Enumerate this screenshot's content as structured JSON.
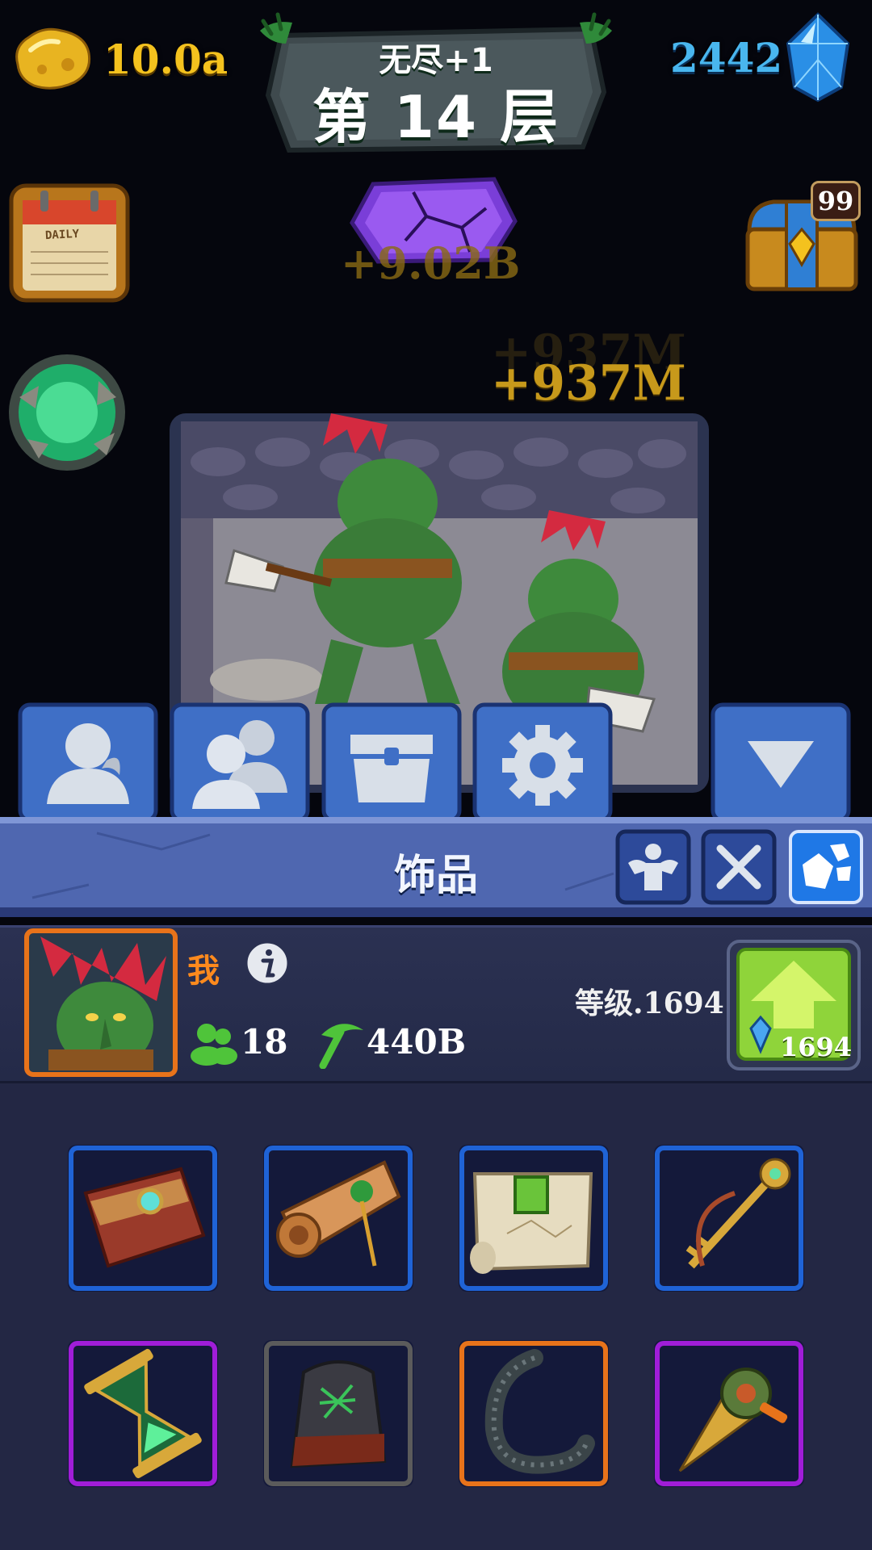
{
  "top_bar": {
    "gold": "10.0a",
    "gems": "2442",
    "floor_subtitle": "无尽+1",
    "floor_title": "第 14 层"
  },
  "side_buttons": {
    "daily_label": "DAILY",
    "chest_count": "99"
  },
  "floating_gains": {
    "crystal_gain": "+9.02B",
    "gain_ghost": "+937M",
    "gain": "+937M"
  },
  "tabs": [
    {
      "icon": "hero-silhouette-icon"
    },
    {
      "icon": "group-silhouette-icon"
    },
    {
      "icon": "chest-icon"
    },
    {
      "icon": "gear-icon"
    },
    {
      "icon": "collapse-triangle-icon"
    }
  ],
  "section": {
    "title": "饰品",
    "filters": [
      {
        "icon": "strength-icon"
      },
      {
        "icon": "crossed-swords-icon"
      },
      {
        "icon": "gem-cluster-icon",
        "active": true
      }
    ]
  },
  "hero": {
    "name": "我",
    "stat_group": "18",
    "stat_mining": "440B",
    "level_text": "等级.1694",
    "upgrade_cost": "1694"
  },
  "items": [
    {
      "icon": "leather-book-icon",
      "rarity": "rare",
      "border": "#1f63d6"
    },
    {
      "icon": "scroll-icon",
      "rarity": "rare",
      "border": "#1f63d6"
    },
    {
      "icon": "map-icon",
      "rarity": "rare",
      "border": "#1f63d6"
    },
    {
      "icon": "key-icon",
      "rarity": "rare",
      "border": "#1f63d6"
    },
    {
      "icon": "hourglass-icon",
      "rarity": "epic",
      "border": "#a01dd8"
    },
    {
      "icon": "rune-stone-icon",
      "rarity": "common",
      "border": "#5b5b5b"
    },
    {
      "icon": "horn-icon",
      "rarity": "legendary",
      "border": "#e8731a"
    },
    {
      "icon": "drill-icon",
      "rarity": "epic",
      "border": "#a01dd8"
    }
  ],
  "colors": {
    "gold_text": "#f4c21e",
    "gem_text": "#49b6ee",
    "hero_name": "#ff8a1d",
    "tab_blue": "#3f6fc6",
    "upgrade_green": "#8fd43a"
  }
}
